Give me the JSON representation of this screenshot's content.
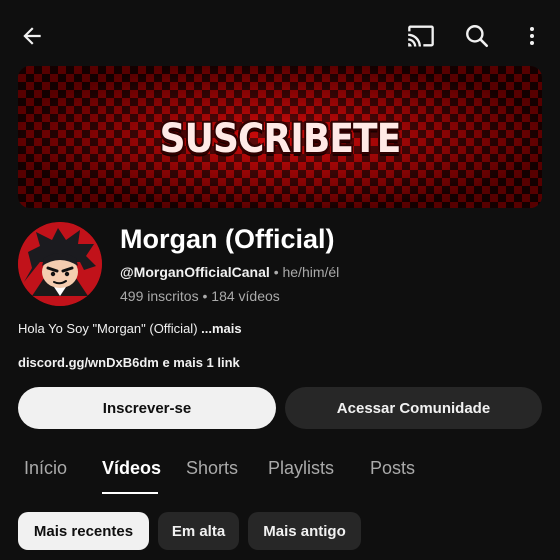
{
  "topbar": {
    "back_icon": "back-arrow-icon",
    "cast_icon": "cast-icon",
    "search_icon": "search-icon",
    "more_icon": "more-vert-icon"
  },
  "banner": {
    "text": "SUSCRIBETE",
    "colors": {
      "red": "#c10000",
      "dark": "#2b0000"
    }
  },
  "channel": {
    "name": "Morgan (Official)",
    "handle": "@MorganOfficialCanal",
    "pronouns": "• he/him/él",
    "subscribers": "499 inscritos",
    "videos": "184 vídeos",
    "stats_separator": "•",
    "description": "Hola Yo Soy \"Morgan\" (Official)",
    "description_more": "...mais",
    "links": "discord.gg/wnDxB6dm e mais 1 link"
  },
  "actions": {
    "subscribe_label": "Inscrever-se",
    "community_label": "Acessar Comunidade"
  },
  "tabs": [
    {
      "label": "Início",
      "active": false
    },
    {
      "label": "Vídeos",
      "active": true
    },
    {
      "label": "Shorts",
      "active": false
    },
    {
      "label": "Playlists",
      "active": false
    },
    {
      "label": "Posts",
      "active": false
    }
  ],
  "filters": [
    {
      "label": "Mais recentes",
      "selected": true
    },
    {
      "label": "Em alta",
      "selected": false
    },
    {
      "label": "Mais antigo",
      "selected": false
    }
  ],
  "colors": {
    "background": "#0f0f0f",
    "primary_button": "#f1f1f1",
    "secondary_button": "#272727",
    "muted_text": "#aaaaaa"
  }
}
